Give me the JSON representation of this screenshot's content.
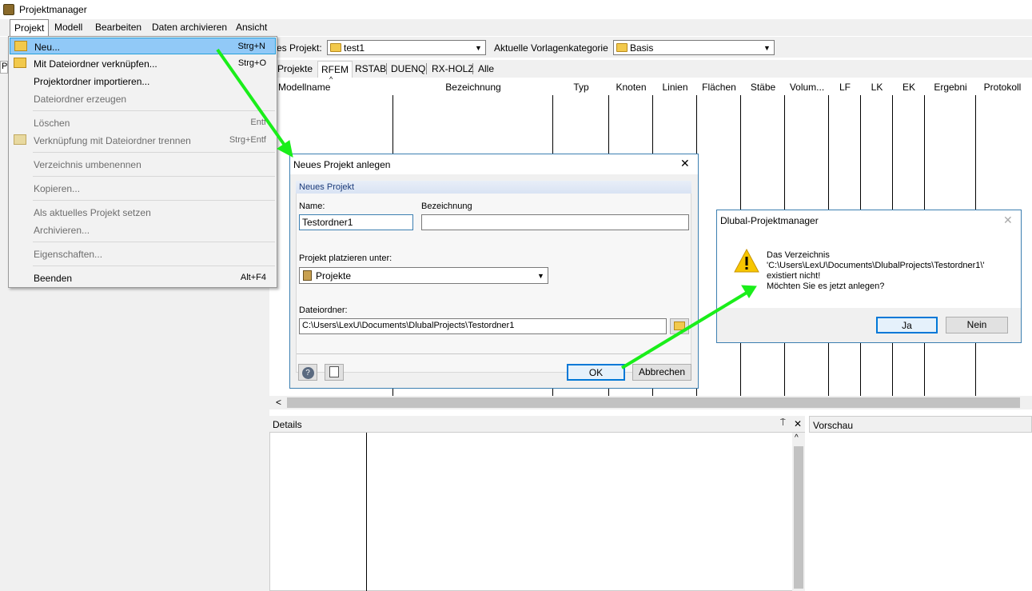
{
  "app": {
    "title": "Projektmanager"
  },
  "menubar": {
    "items": [
      "Projekt",
      "Modell",
      "Bearbeiten",
      "Daten archivieren",
      "Ansicht"
    ]
  },
  "toolbar": {
    "current_project_label": "es Projekt:",
    "current_project_value": "test1",
    "template_category_label": "Aktuelle Vorlagenkategorie",
    "template_category_value": "Basis"
  },
  "tabs": [
    "Projekte",
    "RFEM",
    "RSTAB",
    "DUENQ",
    "RX-HOLZ",
    "Alle"
  ],
  "grid": {
    "columns": [
      "Modellname",
      "Bezeichnung",
      "Typ",
      "Knoten",
      "Linien",
      "Flächen",
      "Stäbe",
      "Volum...",
      "LF",
      "LK",
      "EK",
      "Ergebni",
      "Protokoll"
    ]
  },
  "panels": {
    "details": "Details",
    "preview": "Vorschau",
    "pin": "⍑",
    "close": "✕"
  },
  "left_stub": {
    "letter": "P"
  },
  "menu": {
    "items": [
      {
        "label": "Neu...",
        "shortcut": "Strg+N",
        "disabled": false,
        "selected": true
      },
      {
        "label": "Mit Dateiordner verknüpfen...",
        "shortcut": "Strg+O",
        "disabled": false
      },
      {
        "label": "Projektordner importieren...",
        "shortcut": "",
        "disabled": false
      },
      {
        "label": "Dateiordner erzeugen",
        "shortcut": "",
        "disabled": true
      },
      {
        "label": "Löschen",
        "shortcut": "Entf",
        "disabled": true
      },
      {
        "label": "Verknüpfung mit Dateiordner trennen",
        "shortcut": "Strg+Entf",
        "disabled": true
      },
      {
        "label": "Verzeichnis umbenennen",
        "shortcut": "",
        "disabled": true
      },
      {
        "label": "Kopieren...",
        "shortcut": "",
        "disabled": true
      },
      {
        "label": "Als aktuelles Projekt setzen",
        "shortcut": "",
        "disabled": true
      },
      {
        "label": "Archivieren...",
        "shortcut": "",
        "disabled": true
      },
      {
        "label": "Eigenschaften...",
        "shortcut": "",
        "disabled": true
      },
      {
        "label": "Beenden",
        "shortcut": "Alt+F4",
        "disabled": false
      }
    ]
  },
  "dialog": {
    "title": "Neues Projekt anlegen",
    "section": "Neues Projekt",
    "name_label": "Name:",
    "name_value": "Testordner1",
    "desc_label": "Bezeichnung",
    "desc_value": "",
    "place_label": "Projekt platzieren unter:",
    "place_value": "Projekte",
    "folder_label": "Dateiordner:",
    "folder_value": "C:\\Users\\LexU\\Documents\\DlubalProjects\\Testordner1",
    "ok": "OK",
    "cancel": "Abbrechen"
  },
  "msgbox": {
    "title": "Dlubal-Projektmanager",
    "line1": "Das Verzeichnis",
    "line2": "'C:\\Users\\LexU\\Documents\\DlubalProjects\\Testordner1\\'",
    "line3": "existiert nicht!",
    "line4": "Möchten Sie es jetzt anlegen?",
    "yes": "Ja",
    "no": "Nein"
  },
  "colors": {
    "accent": "#26a0da",
    "arrow": "#1aee1a",
    "selection": "#91c9f7"
  }
}
